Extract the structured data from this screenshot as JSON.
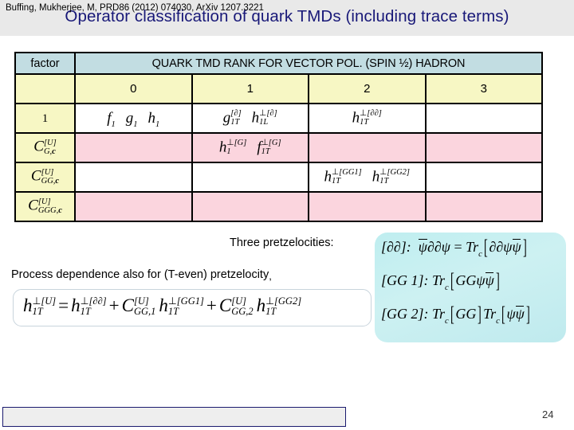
{
  "slide": {
    "title": "Operator classification of quark TMDs (including trace terms)",
    "title_color": "#181878",
    "band_color": "#e9e9e9",
    "page_number": "24"
  },
  "table": {
    "header": {
      "factor_label": "factor",
      "rank_banner": "QUARK TMD RANK FOR VECTOR POL. (SPIN ½) HADRON",
      "rank_columns": [
        "0",
        "1",
        "2",
        "3"
      ],
      "header_color": "#c2dde2",
      "rank_row_color": "#f7f7c4"
    },
    "rows": [
      {
        "factor": "1",
        "factor_kind": "plain",
        "band": "white",
        "cells": [
          "f₁  g₁  h₁",
          "g₁ₜᶠ[∂]  h₁ʟᴻ[∂]",
          "h₁ₜᴻ[∂∂]",
          ""
        ]
      },
      {
        "factor": "C[U] G,c",
        "factor_kind": "math",
        "band": "pink",
        "cells": [
          "",
          "h₁ᴻ[G]  f₁ₜᴻ[G]",
          "",
          ""
        ]
      },
      {
        "factor": "C[U] GG,c",
        "factor_kind": "math",
        "band": "white",
        "cells": [
          "",
          "",
          "h₁ₜᴻ[GG1]  h₁ₜᴻ[GG2]",
          ""
        ]
      },
      {
        "factor": "C[U] GGG,c",
        "factor_kind": "math",
        "band": "pink",
        "cells": [
          "",
          "",
          "",
          ""
        ]
      }
    ],
    "colors": {
      "white_row": "#ffffff",
      "pink_row": "#fbd5de",
      "factor_col": "#f7f7c4",
      "border": "#000000"
    }
  },
  "pretzelocities": {
    "label": "Three pretzelocities:",
    "box_color": "#c5eef0",
    "lines": [
      "[∂∂]:  ψ̄∂∂ψ = Tr_c[∂∂ψψ̄]",
      "[GG 1]: Tr_c[GGψψ̄]",
      "[GG 2]: Tr_c[GG]Tr_c[ψψ̄]"
    ]
  },
  "process": {
    "text": "Process dependence also for (T-even) pretzelocity",
    "trailing_comma": ",",
    "formula": "h₁ₜᴻ[U] = h₁ₜᴻ[∂∂] + C[U]GG,1 h₁ₜᴻ[GG1] + C[U]GG,2 h₁ₜᴻ[GG2]"
  },
  "citation": {
    "text": "Buffing, Mukherjee, M, PRD86 (2012) 074030, ArXiv 1207.3221",
    "border_color": "#1a1a6e"
  }
}
